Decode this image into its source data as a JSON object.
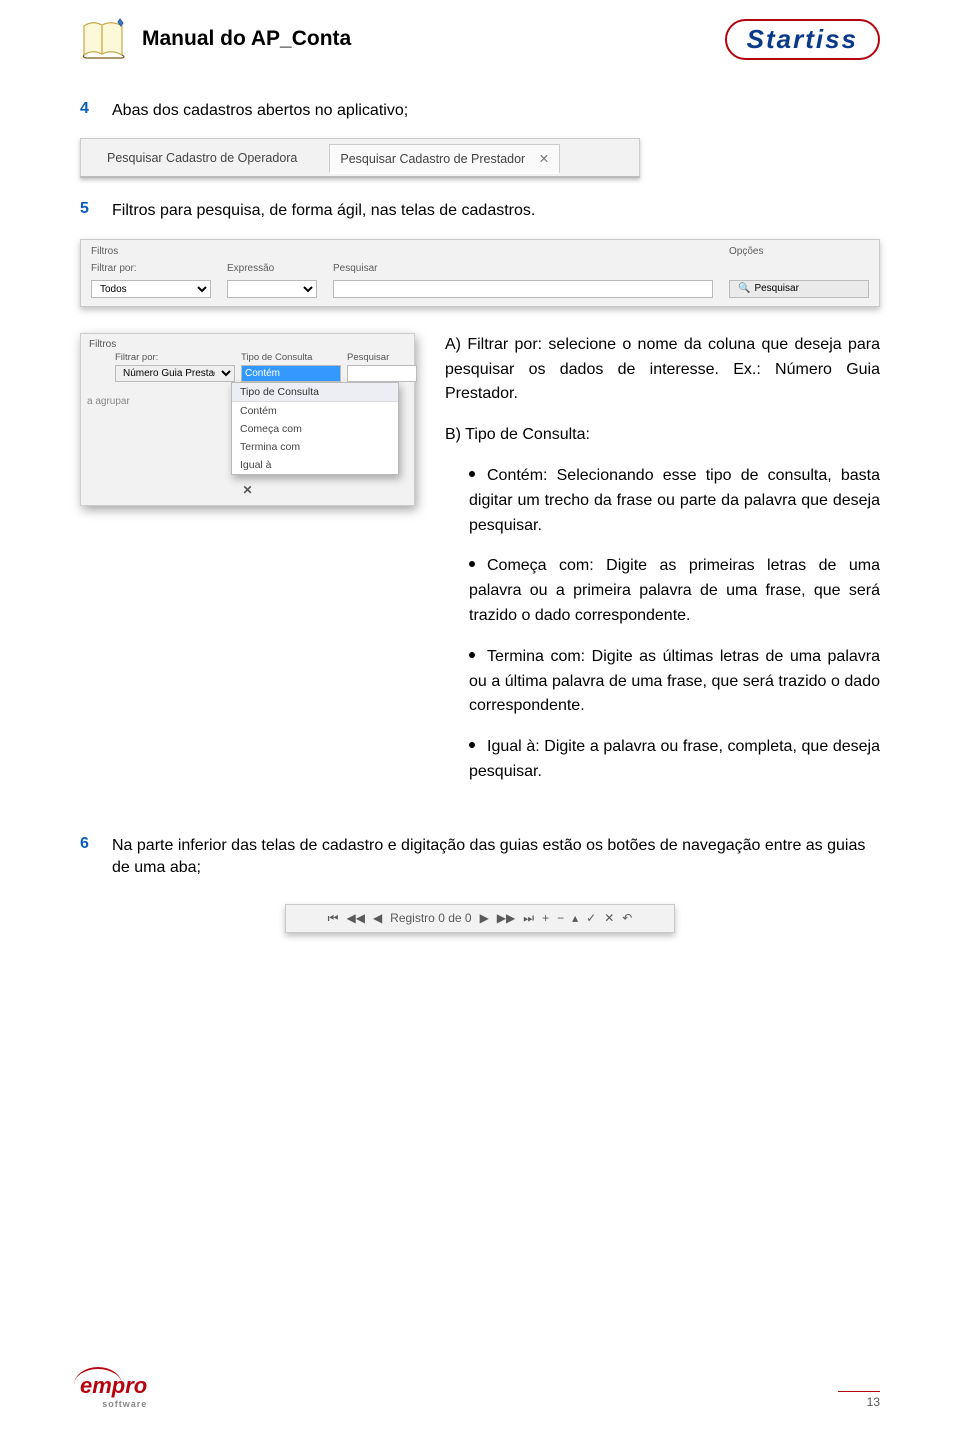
{
  "header": {
    "title": "Manual do AP_Conta",
    "logo_text": "Startiss"
  },
  "section4": {
    "num": "4",
    "text": "Abas dos cadastros abertos no aplicativo;"
  },
  "tabs": {
    "tab1": "Pesquisar Cadastro de Operadora",
    "tab2": "Pesquisar Cadastro de Prestador",
    "close": "✕"
  },
  "section5": {
    "num": "5",
    "text": "Filtros para pesquisa, de forma ágil, nas telas de cadastros."
  },
  "filterbar": {
    "h_filtros": "Filtros",
    "h_filtrar": "Filtrar por:",
    "h_expr": "Expressão",
    "h_pesq": "Pesquisar",
    "h_opc": "Opções",
    "sel_todos": "Todos",
    "btn": "Pesquisar"
  },
  "dropdown": {
    "h_filtros": "Filtros",
    "h_filtrar": "Filtrar por:",
    "h_tipo": "Tipo de Consulta",
    "h_pesq": "Pesquisar",
    "sel_filtrar": "Número Guia Prestador",
    "sel_tipo": "Contém",
    "agrupar": "a agrupar",
    "list_head": "Tipo de Consulta",
    "opt1": "Contém",
    "opt2": "Começa com",
    "opt3": "Termina com",
    "opt4": "Igual à",
    "x": "✕"
  },
  "explain": {
    "a": "A) Filtrar por: selecione o nome da coluna que deseja para pesquisar os dados de interesse. Ex.: Número Guia Prestador.",
    "b_intro": "B) Tipo de Consulta:",
    "b1": "Contém: Selecionando esse tipo de consulta, basta digitar um trecho da frase ou parte da palavra que deseja pesquisar.",
    "b2": "Começa com: Digite as primeiras letras de uma palavra ou a primeira palavra de uma frase, que será trazido o dado correspondente.",
    "b3": "Termina com: Digite as últimas letras de uma palavra ou a última palavra de uma frase, que será trazido o dado correspondente.",
    "b4": "Igual à: Digite a palavra ou frase, completa, que deseja pesquisar."
  },
  "section6": {
    "num": "6",
    "text": "Na parte inferior das telas de cadastro e digitação das guias estão os botões de navegação entre as guias de uma aba;"
  },
  "navbar": {
    "first": "⏮",
    "prevpg": "◀◀",
    "prev": "◀",
    "label": "Registro 0 de 0",
    "next": "▶",
    "nextpg": "▶▶",
    "last": "⏭",
    "plus": "+",
    "minus": "−",
    "up": "▴",
    "check": "✓",
    "x": "✕",
    "back": "↶"
  },
  "footer": {
    "brand1": "empro",
    "brand2": "software",
    "page": "13"
  }
}
